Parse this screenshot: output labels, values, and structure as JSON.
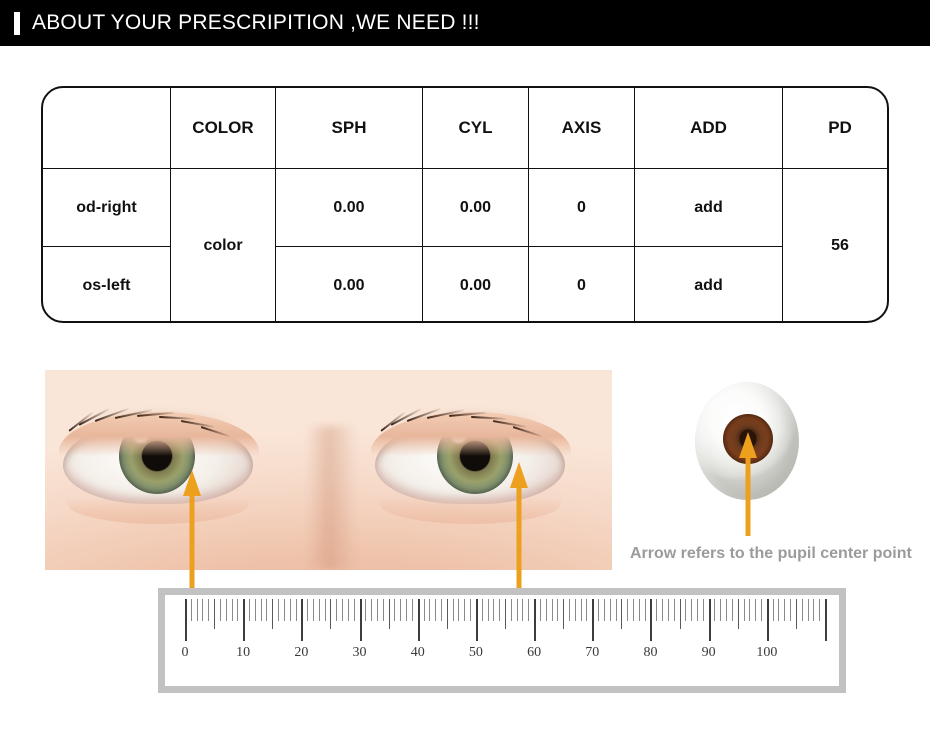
{
  "header": {
    "title": "ABOUT YOUR PRESCRIPITION ,WE NEED !!!",
    "accent_color": "#ffffff",
    "background_color": "#000000"
  },
  "prescription_table": {
    "columns": [
      "",
      "COLOR",
      "SPH",
      "CYL",
      "AXIS",
      "ADD",
      "PD"
    ],
    "rows": [
      {
        "eye": "od-right",
        "color": "color",
        "sph": "0.00",
        "cyl": "0.00",
        "axis": "0",
        "add": "add",
        "pd": "56"
      },
      {
        "eye": "os-left",
        "color": "color",
        "sph": "0.00",
        "cyl": "0.00",
        "axis": "0",
        "add": "add",
        "pd": "56"
      }
    ],
    "border_color": "#111111"
  },
  "illustration": {
    "caption": "Arrow refers to the pupil center point",
    "caption_color": "#9b9b99",
    "arrow_color": "#eda01e",
    "eyes_photo_alt": "close-up photo of a pair of human eyes",
    "eyeball_alt": "illustration of a single eyeball with brown iris"
  },
  "ruler": {
    "labels": [
      "0",
      "10",
      "20",
      "30",
      "40",
      "50",
      "60",
      "70",
      "80",
      "90",
      "100"
    ],
    "unit_start": 0,
    "unit_end": 110,
    "frame_color": "#c2c2c2",
    "measured_value": "56"
  }
}
